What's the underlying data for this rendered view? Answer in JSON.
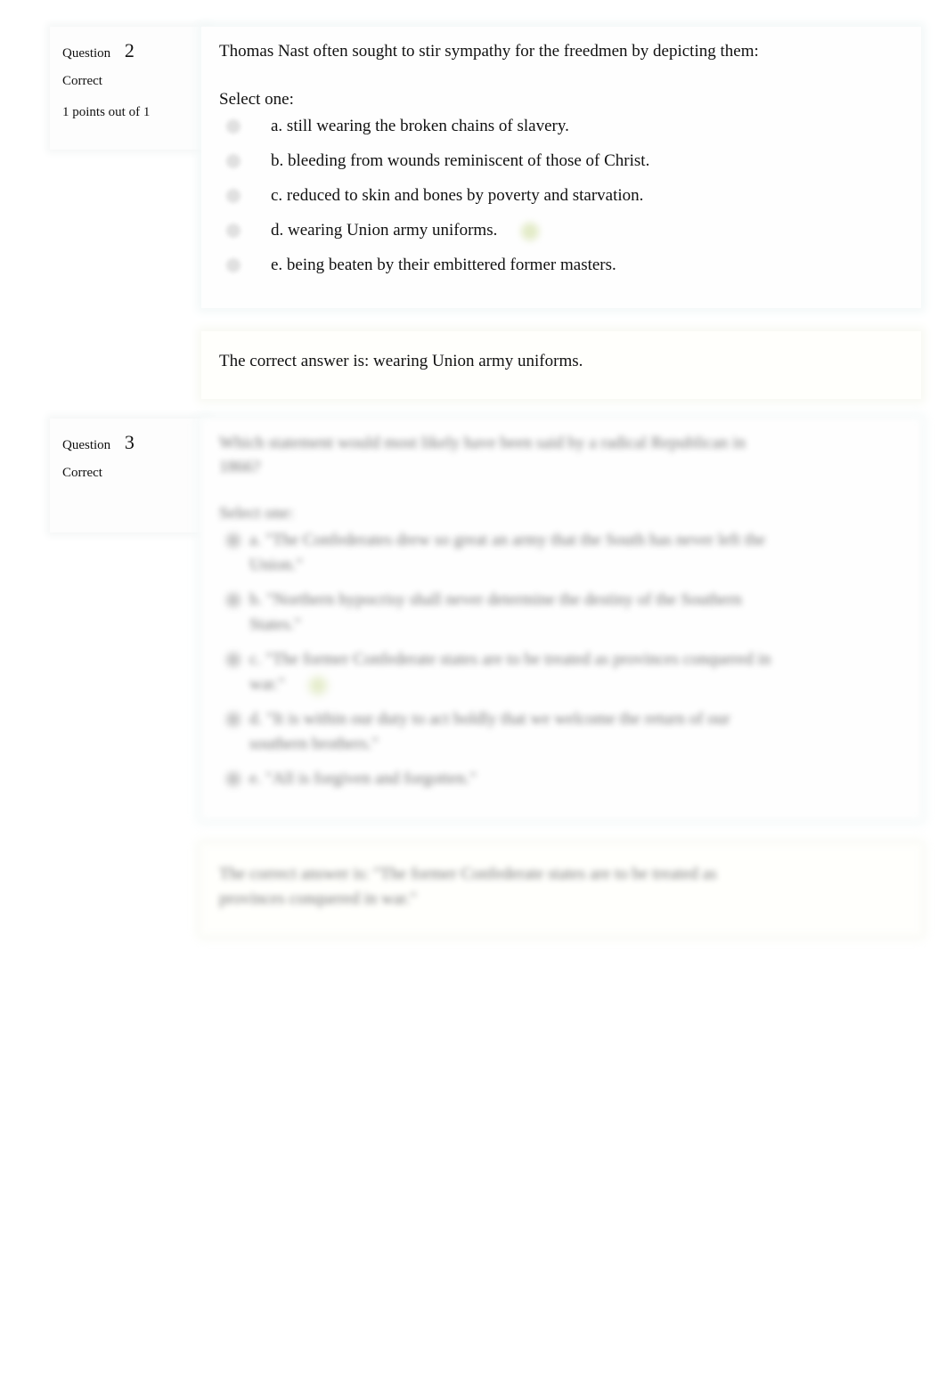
{
  "questions": [
    {
      "label": "Question",
      "number": "2",
      "state": "Correct",
      "grade": "1 points out of 1",
      "text": "Thomas Nast often sought to stir sympathy for the freedmen by depicting them:",
      "prompt": "Select one:",
      "options": [
        "a. still wearing the broken chains of slavery.",
        "b. bleeding from wounds reminiscent of those of Christ.",
        "c. reduced to skin and bones by poverty and starvation.",
        "d. wearing Union army uniforms.",
        "e. being beaten by their embittered former masters."
      ],
      "selected_index": 3,
      "feedback": "The correct answer is: wearing Union army uniforms.",
      "check_color": "#e3ebc8"
    },
    {
      "label": "Question",
      "number": "3",
      "state": "Correct",
      "text": "Which statement would most likely have been said by a radical Republican in 1866?",
      "prompt": "Select one:",
      "options": [
        "a. \"The Confederates drew so great an army that the South has never left the Union.\"",
        "b. \"Northern hypocrisy shall never determine the destiny of the Southern States.\"",
        "c. \"The former Confederate states are to be treated as provinces conquered in war.\"",
        "d. \"It is within our duty to act boldly that we welcome the return of our southern brothers.\"",
        "e. \"All is forgiven and forgotten.\""
      ],
      "selected_index": 2,
      "feedback": "The correct answer is: \"The former Confederate states are to be treated as provinces conquered in war.\"",
      "blurred": true
    }
  ]
}
